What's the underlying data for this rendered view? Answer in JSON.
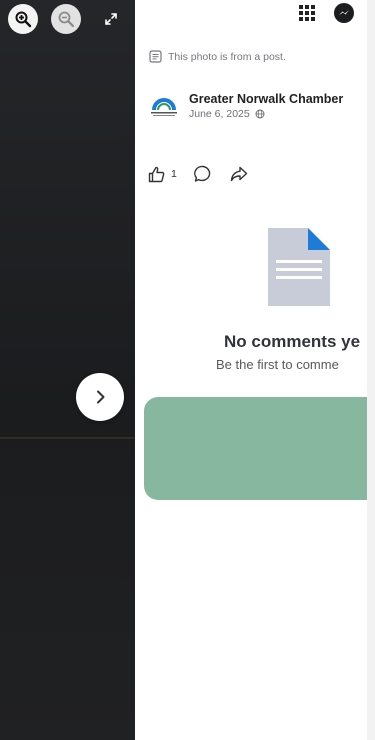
{
  "viewer": {
    "zoom_in_icon": "zoom-in-icon",
    "zoom_out_icon": "zoom-out-icon",
    "fullscreen_icon": "expand-icon",
    "next_icon": "chevron-right-icon"
  },
  "panel": {
    "note": "This photo is from a post.",
    "author": "Greater Norwalk Chamber",
    "date": "June 6, 2025",
    "privacy_icon": "globe-icon",
    "likes_count": "1",
    "empty_title": "No comments ye",
    "empty_subtitle": "Be the first to comme"
  },
  "colors": {
    "viewer_bg": "#1f2022",
    "accent_blue": "#1e7bd8",
    "cta_green": "#88b79f"
  }
}
